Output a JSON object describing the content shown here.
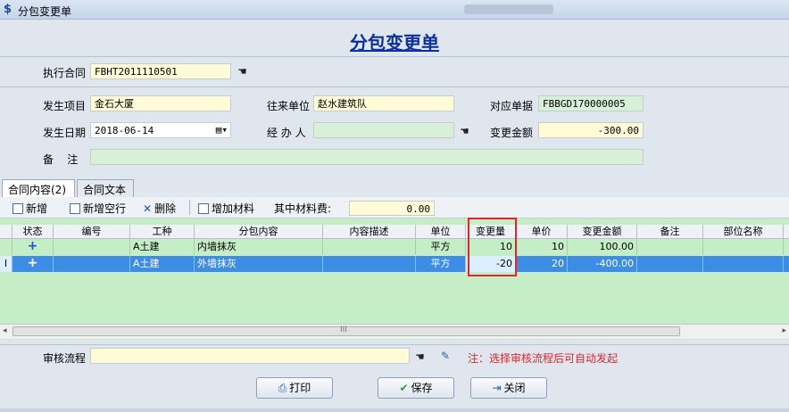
{
  "window": {
    "title": "分包变更单"
  },
  "form": {
    "title": "分包变更单"
  },
  "fields": {
    "contract_label": "执行合同",
    "contract_value": "FBHT2011110501",
    "project_label": "发生项目",
    "project_value": "金石大厦",
    "partner_label": "往来单位",
    "partner_value": "赵水建筑队",
    "doc_label": "对应单据",
    "doc_value": "FBBGD170000005",
    "date_label": "发生日期",
    "date_value": "2018-06-14",
    "handler_label": "经 办 人",
    "handler_value": "",
    "amount_label": "变更金额",
    "amount_value": "-300.00",
    "remark_label": "备    注",
    "remark_value": ""
  },
  "tabs": [
    {
      "label": "合同内容(2)",
      "active": true
    },
    {
      "label": "合同文本",
      "active": false
    }
  ],
  "toolbar": {
    "add": "新增",
    "add_blank": "新增空行",
    "delete": "删除",
    "add_material": "增加材料",
    "material_fee_label": "其中材料费:",
    "material_fee_value": "0.00"
  },
  "table": {
    "columns": [
      "状态",
      "编号",
      "工种",
      "分包内容",
      "内容描述",
      "单位",
      "变更量",
      "单价",
      "变更金额",
      "备注",
      "部位名称"
    ],
    "rows": [
      {
        "indicator": "",
        "status": "+",
        "code": "",
        "type": "A土建",
        "content": "内墙抹灰",
        "desc": "",
        "unit": "平方",
        "qty": "10",
        "price": "10",
        "amount": "100.00",
        "note": "",
        "part": ""
      },
      {
        "indicator": "I",
        "status": "+",
        "code": "",
        "type": "A土建",
        "content": "外墙抹灰",
        "desc": "",
        "unit": "平方",
        "qty": "-20",
        "price": "20",
        "amount": "-400.00",
        "note": "",
        "part": ""
      }
    ]
  },
  "scroll": {
    "middle": "III"
  },
  "footer": {
    "workflow_label": "审核流程",
    "workflow_value": "",
    "note": "注：选择审核流程后可自动发起",
    "print": "打印",
    "save": "保存",
    "close": "关闭"
  },
  "colors": {
    "title_blue": "#0b2f9b",
    "highlight_red": "#e0262b",
    "row_selected": "#3d8ce6",
    "grid_green": "#c6eec6"
  }
}
